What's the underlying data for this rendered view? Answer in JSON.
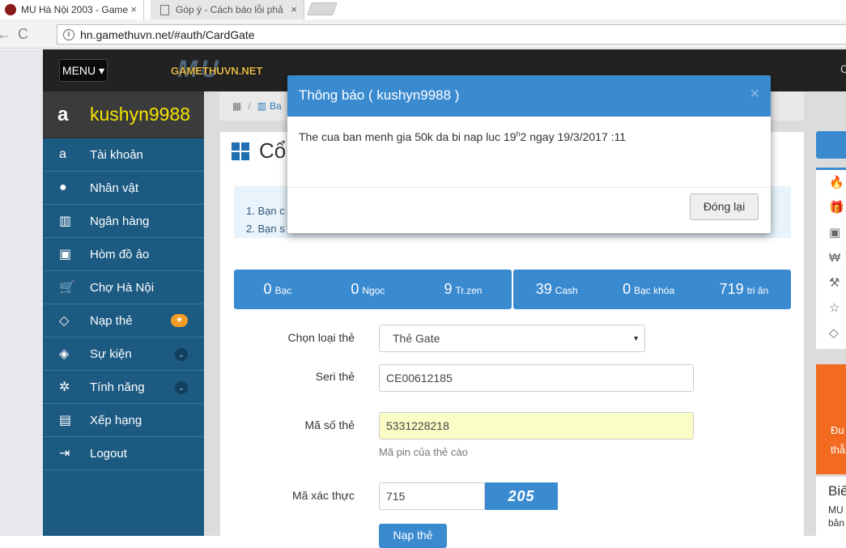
{
  "browser": {
    "tabs": [
      {
        "title": "MU Hà Nội 2003 - Game",
        "close": "×"
      },
      {
        "title": "Góp ý - Cách báo lỗi phả",
        "close": "×"
      }
    ],
    "back": "←",
    "forward": "→",
    "reload": "C",
    "url": "hn.gamethuvn.net/#auth/CardGate"
  },
  "topnav": {
    "menu_label": "MENU ▾",
    "logo_big": "MU",
    "logo_text": "GAMETHUVN.NET",
    "right_letter": "C"
  },
  "sidebar": {
    "username": "kushyn9988",
    "items": [
      {
        "label": "Tài khoản",
        "icon": "a"
      },
      {
        "label": "Nhân vật",
        "icon": "●"
      },
      {
        "label": "Ngân hàng",
        "icon": "▥"
      },
      {
        "label": "Hòm đồ ảo",
        "icon": "▣"
      },
      {
        "label": "Chợ Hà Nội",
        "icon": "🛒"
      },
      {
        "label": "Nạp thẻ",
        "icon": "◇",
        "badge": "★"
      },
      {
        "label": "Sự kiện",
        "icon": "◈",
        "chevron": "⌄"
      },
      {
        "label": "Tính năng",
        "icon": "✲",
        "chevron": "⌄"
      },
      {
        "label": "Xếp hạng",
        "icon": "▤"
      },
      {
        "label": "Logout",
        "icon": "⇥"
      }
    ]
  },
  "breadcrumb": {
    "home_icon": "▦",
    "sep": "/",
    "item": "Ba"
  },
  "panel": {
    "title": "Cổ",
    "info_lines": [
      "1. Bạn c",
      "2. Bạn s"
    ],
    "stats_left": [
      {
        "value": "0",
        "unit": "Bạc"
      },
      {
        "value": "0",
        "unit": "Ngọc"
      },
      {
        "value": "9",
        "unit": "Tr.zen"
      }
    ],
    "stats_right": [
      {
        "value": "39",
        "unit": "Cash"
      },
      {
        "value": "0",
        "unit": "Bạc khóa"
      },
      {
        "value": "719",
        "unit": "tri ân"
      }
    ],
    "form": {
      "card_type_label": "Chọn loại thẻ",
      "card_type_value": "Thẻ Gate",
      "serial_label": "Seri thẻ",
      "serial_value": "CE00612185",
      "pin_label": "Mã số thẻ",
      "pin_value": "5331228218",
      "pin_hint": "Mã pin của thẻ cào",
      "captcha_label": "Mã xác thực",
      "captcha_value": "715",
      "captcha_image_text": "205",
      "submit_label": "Nạp thẻ"
    }
  },
  "right_panel": {
    "box_icons": [
      "🔥",
      "🎁",
      "▣",
      "₩",
      "⚒",
      "☆",
      "◇"
    ],
    "orange_lines": [
      "Đu",
      "thẫ"
    ],
    "white_title": "Biế",
    "white_lines": [
      "MU",
      "bản"
    ]
  },
  "modal": {
    "title": "Thông báo ( kushyn9988 )",
    "close": "×",
    "message_pre": "The cua ban menh gia 50k da bi nap luc 19",
    "message_sup": "h",
    "message_post": "2 ngay 19/3/2017 :11",
    "button": "Đóng lại"
  }
}
